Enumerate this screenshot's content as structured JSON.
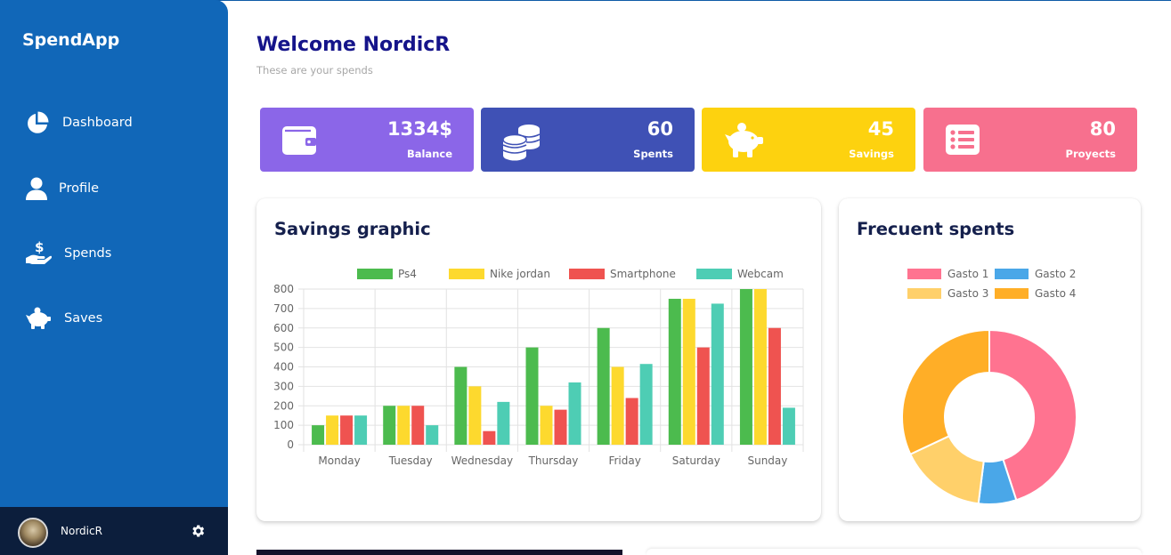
{
  "app": {
    "brand": "SpendApp"
  },
  "sidebar": {
    "items": [
      {
        "label": "Dashboard",
        "icon": "pie-chart-icon"
      },
      {
        "label": "Profile",
        "icon": "user-icon"
      },
      {
        "label": "Spends",
        "icon": "hand-dollar-icon"
      },
      {
        "label": "Saves",
        "icon": "piggy-bank-icon"
      }
    ],
    "user": {
      "name": "NordicR"
    }
  },
  "header": {
    "title": "Welcome NordicR",
    "subtitle": "These are your spends"
  },
  "stats": [
    {
      "value": "1334$",
      "label": "Balance",
      "icon": "wallet-icon",
      "color": "#8b66e8"
    },
    {
      "value": "60",
      "label": "Spents",
      "icon": "coins-icon",
      "color": "#3f51b5"
    },
    {
      "value": "45",
      "label": "Savings",
      "icon": "piggy-bank-icon",
      "color": "#fdd20f"
    },
    {
      "value": "80",
      "label": "Proyects",
      "icon": "list-icon",
      "color": "#f7708e"
    }
  ],
  "savings_panel": {
    "title": "Savings graphic"
  },
  "frequent_panel": {
    "title": "Frecuent spents"
  },
  "chart_data": [
    {
      "type": "bar",
      "categories": [
        "Monday",
        "Tuesday",
        "Wednesday",
        "Thursday",
        "Friday",
        "Saturday",
        "Sunday"
      ],
      "series": [
        {
          "name": "Ps4",
          "color": "#4cbb4e",
          "values": [
            100,
            200,
            400,
            500,
            600,
            750,
            800
          ]
        },
        {
          "name": "Nike jordan",
          "color": "#fdd92e",
          "values": [
            150,
            200,
            300,
            200,
            400,
            750,
            800
          ]
        },
        {
          "name": "Smartphone",
          "color": "#ef5350",
          "values": [
            150,
            200,
            70,
            180,
            240,
            500,
            600
          ]
        },
        {
          "name": "Webcam",
          "color": "#4ecdb4",
          "values": [
            150,
            100,
            220,
            320,
            415,
            725,
            190
          ]
        }
      ],
      "ylim": [
        0,
        800
      ],
      "yticks": [
        "0",
        "100",
        "200",
        "300",
        "400",
        "500",
        "600",
        "700",
        "800"
      ],
      "legend": "top",
      "grid": true
    },
    {
      "type": "pie",
      "variant": "doughnut",
      "labels": [
        "Gasto 1",
        "Gasto 2",
        "Gasto 3",
        "Gasto 4"
      ],
      "values": [
        45,
        7,
        16,
        32
      ],
      "colors": [
        "#ff7390",
        "#4aa7e8",
        "#ffd06a",
        "#ffae27"
      ],
      "legend": "top"
    }
  ]
}
